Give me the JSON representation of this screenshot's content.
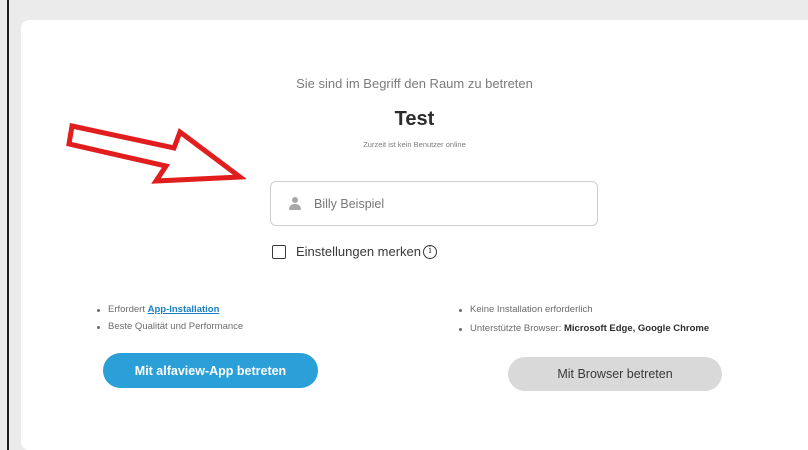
{
  "room": {
    "intro": "Sie sind im Begriff den Raum zu betreten",
    "title": "Test",
    "online_status": "Zurzeit ist kein Benutzer online"
  },
  "name_field": {
    "placeholder": "Billy Beispiel",
    "value": "",
    "icon": "user-icon"
  },
  "remember": {
    "label": "Einstellungen merken",
    "checked": false,
    "info_icon": "info-icon",
    "info_glyph": "i"
  },
  "app_option": {
    "requires_prefix": "Erfordert ",
    "requires_link": "App-Installation",
    "quality": "Beste Qualität und Performance",
    "button_label": "Mit alfaview-App betreten"
  },
  "browser_option": {
    "no_install": "Keine Installation erforderlich",
    "supported_prefix": "Unterstützte Browser: ",
    "supported_browsers": "Microsoft Edge, Google Chrome",
    "button_label": "Mit Browser betreten"
  },
  "colors": {
    "primary_button": "#2a9fd8",
    "secondary_button": "#d9d9d9",
    "annotation_arrow": "#e11d1d",
    "link": "#1a7fc1"
  },
  "annotation": {
    "arrow_icon": "right-arrow-icon"
  }
}
